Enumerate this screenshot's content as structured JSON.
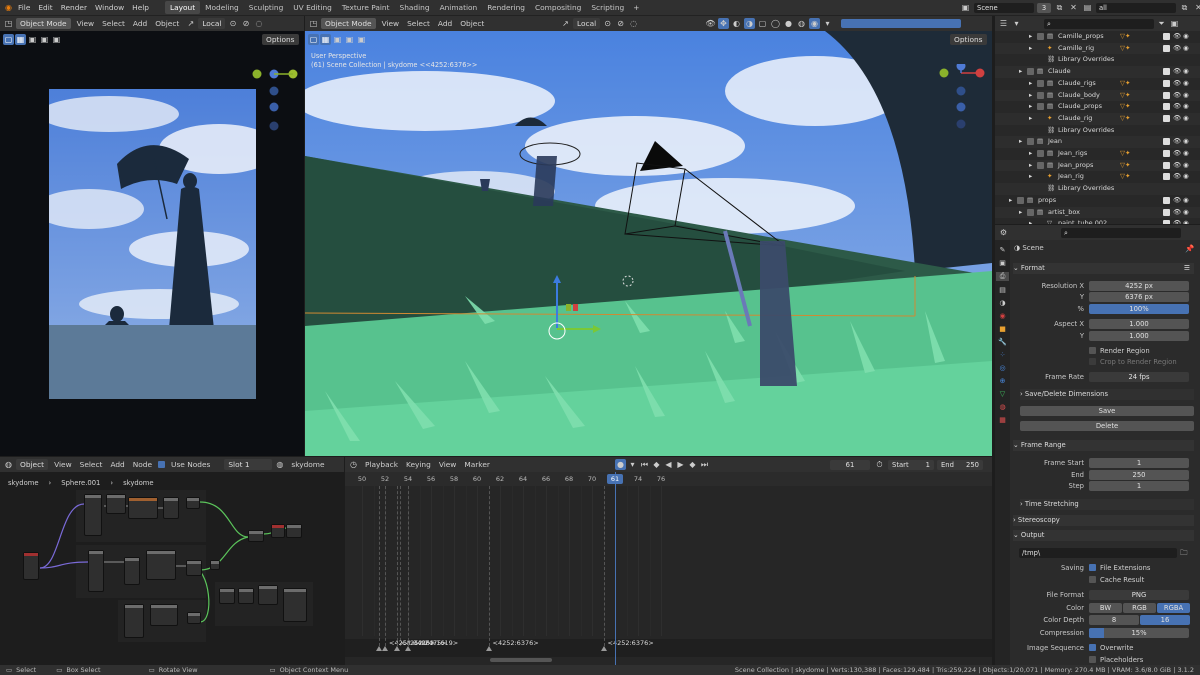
{
  "topbar": {
    "menus": [
      "File",
      "Edit",
      "Render",
      "Window",
      "Help"
    ],
    "workspaces": [
      "Layout",
      "Modeling",
      "Sculpting",
      "UV Editing",
      "Texture Paint",
      "Shading",
      "Animation",
      "Rendering",
      "Compositing",
      "Scripting"
    ],
    "active_workspace": "Layout",
    "add_tab": "+",
    "scene_label": "Scene",
    "scene_count": "3",
    "view_layer_label": "all"
  },
  "left_view": {
    "mode": "Object Mode",
    "menus": [
      "View",
      "Select",
      "Add",
      "Object"
    ],
    "transform": "Local",
    "options": "Options"
  },
  "center_view": {
    "mode": "Object Mode",
    "menus": [
      "View",
      "Select",
      "Add",
      "Object"
    ],
    "transform": "Local",
    "options": "Options",
    "overlay_title": "User Perspective",
    "overlay_sub": "(61) Scene Collection | skydome <<4252:6376>>"
  },
  "outliner": {
    "search_placeholder": "",
    "rows": [
      {
        "indent": 3,
        "label": "Camille_props",
        "type": "coll"
      },
      {
        "indent": 3,
        "label": "Camille_rig",
        "type": "armature"
      },
      {
        "indent": 3,
        "label": "Library Overrides",
        "type": "lib"
      },
      {
        "indent": 2,
        "label": "Claude",
        "type": "coll"
      },
      {
        "indent": 3,
        "label": "Claude_rigs",
        "type": "coll"
      },
      {
        "indent": 3,
        "label": "Claude_body",
        "type": "coll"
      },
      {
        "indent": 3,
        "label": "Claude_props",
        "type": "coll"
      },
      {
        "indent": 3,
        "label": "Claude_rig",
        "type": "armature"
      },
      {
        "indent": 3,
        "label": "Library Overrides",
        "type": "lib"
      },
      {
        "indent": 2,
        "label": "Jean",
        "type": "coll"
      },
      {
        "indent": 3,
        "label": "Jean_rigs",
        "type": "coll"
      },
      {
        "indent": 3,
        "label": "Jean_props",
        "type": "coll"
      },
      {
        "indent": 3,
        "label": "Jean_rig",
        "type": "armature"
      },
      {
        "indent": 3,
        "label": "Library Overrides",
        "type": "lib"
      },
      {
        "indent": 1,
        "label": "props",
        "type": "coll"
      },
      {
        "indent": 2,
        "label": "artist_box",
        "type": "coll"
      },
      {
        "indent": 3,
        "label": "paint_tube.002",
        "type": "mesh"
      }
    ]
  },
  "properties": {
    "scene_label": "Scene",
    "format": {
      "title": "Format",
      "res_x_label": "Resolution X",
      "res_x": "4252 px",
      "res_y_label": "Y",
      "res_y": "6376 px",
      "pct_label": "%",
      "pct": "100%",
      "aspect_x_label": "Aspect X",
      "aspect_x": "1.000",
      "aspect_y_label": "Y",
      "aspect_y": "1.000",
      "render_region": "Render Region",
      "crop": "Crop to Render Region",
      "frame_rate_label": "Frame Rate",
      "frame_rate": "24 fps",
      "save_delete": "Save/Delete Dimensions",
      "save": "Save",
      "delete": "Delete"
    },
    "frame_range": {
      "title": "Frame Range",
      "start_label": "Frame Start",
      "start": "1",
      "end_label": "End",
      "end": "250",
      "step_label": "Step",
      "step": "1",
      "time_stretching": "Time Stretching"
    },
    "stereoscopy": "Stereoscopy",
    "output": {
      "title": "Output",
      "path": "/tmp\\",
      "saving_label": "Saving",
      "file_ext": "File Extensions",
      "cache_result": "Cache Result",
      "file_format_label": "File Format",
      "file_format": "PNG",
      "color_label": "Color",
      "color_opts": [
        "BW",
        "RGB",
        "RGBA"
      ],
      "color_active": "RGBA",
      "depth_label": "Color Depth",
      "depth_opts": [
        "8",
        "16"
      ],
      "depth_active": "16",
      "compression_label": "Compression",
      "compression": "15%",
      "compression_value": 0.15,
      "img_seq_label": "Image Sequence",
      "overwrite": "Overwrite",
      "placeholders": "Placeholders"
    }
  },
  "node_editor": {
    "type": "Object",
    "menus": [
      "View",
      "Select",
      "Add",
      "Node"
    ],
    "use_nodes": "Use Nodes",
    "slot": "Slot 1",
    "material": "skydome",
    "breadcrumb": [
      "skydome",
      "Sphere.001",
      "skydome"
    ]
  },
  "timeline": {
    "menus": [
      "Playback",
      "Keying",
      "View",
      "Marker"
    ],
    "current": "61",
    "start_label": "Start",
    "start": "1",
    "end_label": "End",
    "end": "250",
    "ticks": [
      "50",
      "52",
      "54",
      "56",
      "58",
      "60",
      "61",
      "62",
      "64",
      "66",
      "68",
      "70",
      "72",
      "74",
      "76"
    ],
    "markers": [
      "<4252:3400>",
      "<4252:2475>",
      "<4252:1619>",
      "<4252:6376>",
      "<4252:6376>"
    ]
  },
  "status": {
    "select": "Select",
    "box_select": "Box Select",
    "rotate": "Rotate View",
    "context": "Object Context Menu",
    "stats": "Scene Collection | skydome | Verts:130,388 | Faces:129,484 | Tris:259,224 | Objects:1/20,071 | Memory: 270.4 MB | VRAM: 3.6/8.0 GiB | 3.1.2"
  }
}
